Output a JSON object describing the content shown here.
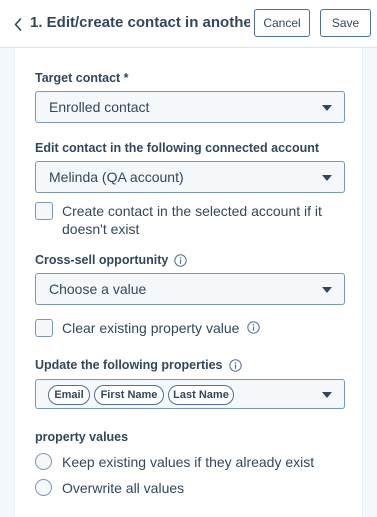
{
  "header": {
    "title": "1. Edit/create contact in anothe...",
    "cancel_label": "Cancel",
    "save_label": "Save"
  },
  "target_contact": {
    "label": "Target contact *",
    "value": "Enrolled contact"
  },
  "connected_account": {
    "label": "Edit contact in the following connected account",
    "value": "Melinda (QA account)",
    "create_checkbox_label": "Create contact in the selected account if it doesn't exist",
    "create_checked": false
  },
  "cross_sell": {
    "label": "Cross-sell opportunity",
    "placeholder": "Choose a value",
    "clear_checkbox_label": "Clear existing property value",
    "clear_checked": false
  },
  "update_properties": {
    "label": "Update the following properties",
    "tags": [
      "Email",
      "First Name",
      "Last Name"
    ]
  },
  "property_values": {
    "label": "property values",
    "options": [
      "Keep existing values if they already exist",
      "Overwrite all values"
    ]
  },
  "icons": {
    "back": "chevron-left-icon",
    "info": "info-icon",
    "dropdown": "caret-down-icon"
  },
  "colors": {
    "text": "#33475b",
    "border": "#7c98b6",
    "field_bg": "#f5f8fa"
  }
}
